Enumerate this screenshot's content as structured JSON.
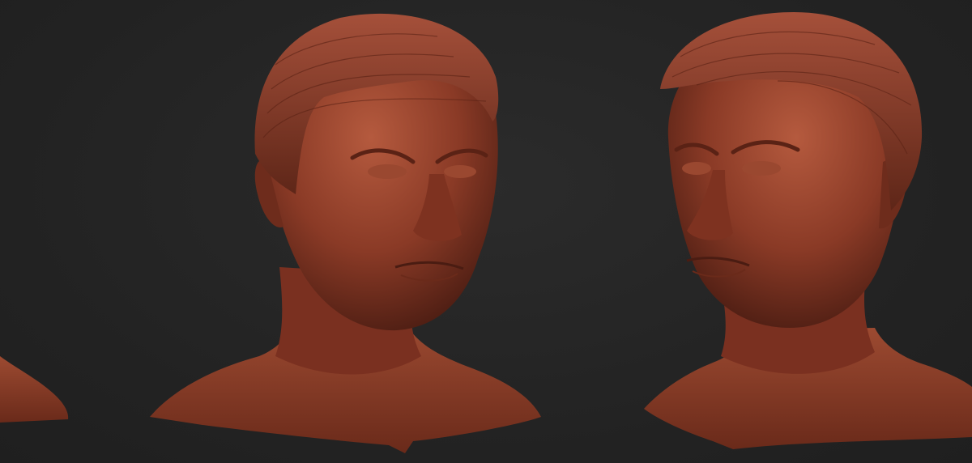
{
  "scene": {
    "background_color": "#242424",
    "material_color": "#8a3a26",
    "material_highlight": "#b85a40",
    "material_shadow": "#4a1c12",
    "views": [
      {
        "name": "partial-bust-left-edge",
        "visible": "partial"
      },
      {
        "name": "bust-three-quarter-left",
        "visible": "full"
      },
      {
        "name": "bust-three-quarter-right",
        "visible": "full"
      }
    ]
  }
}
